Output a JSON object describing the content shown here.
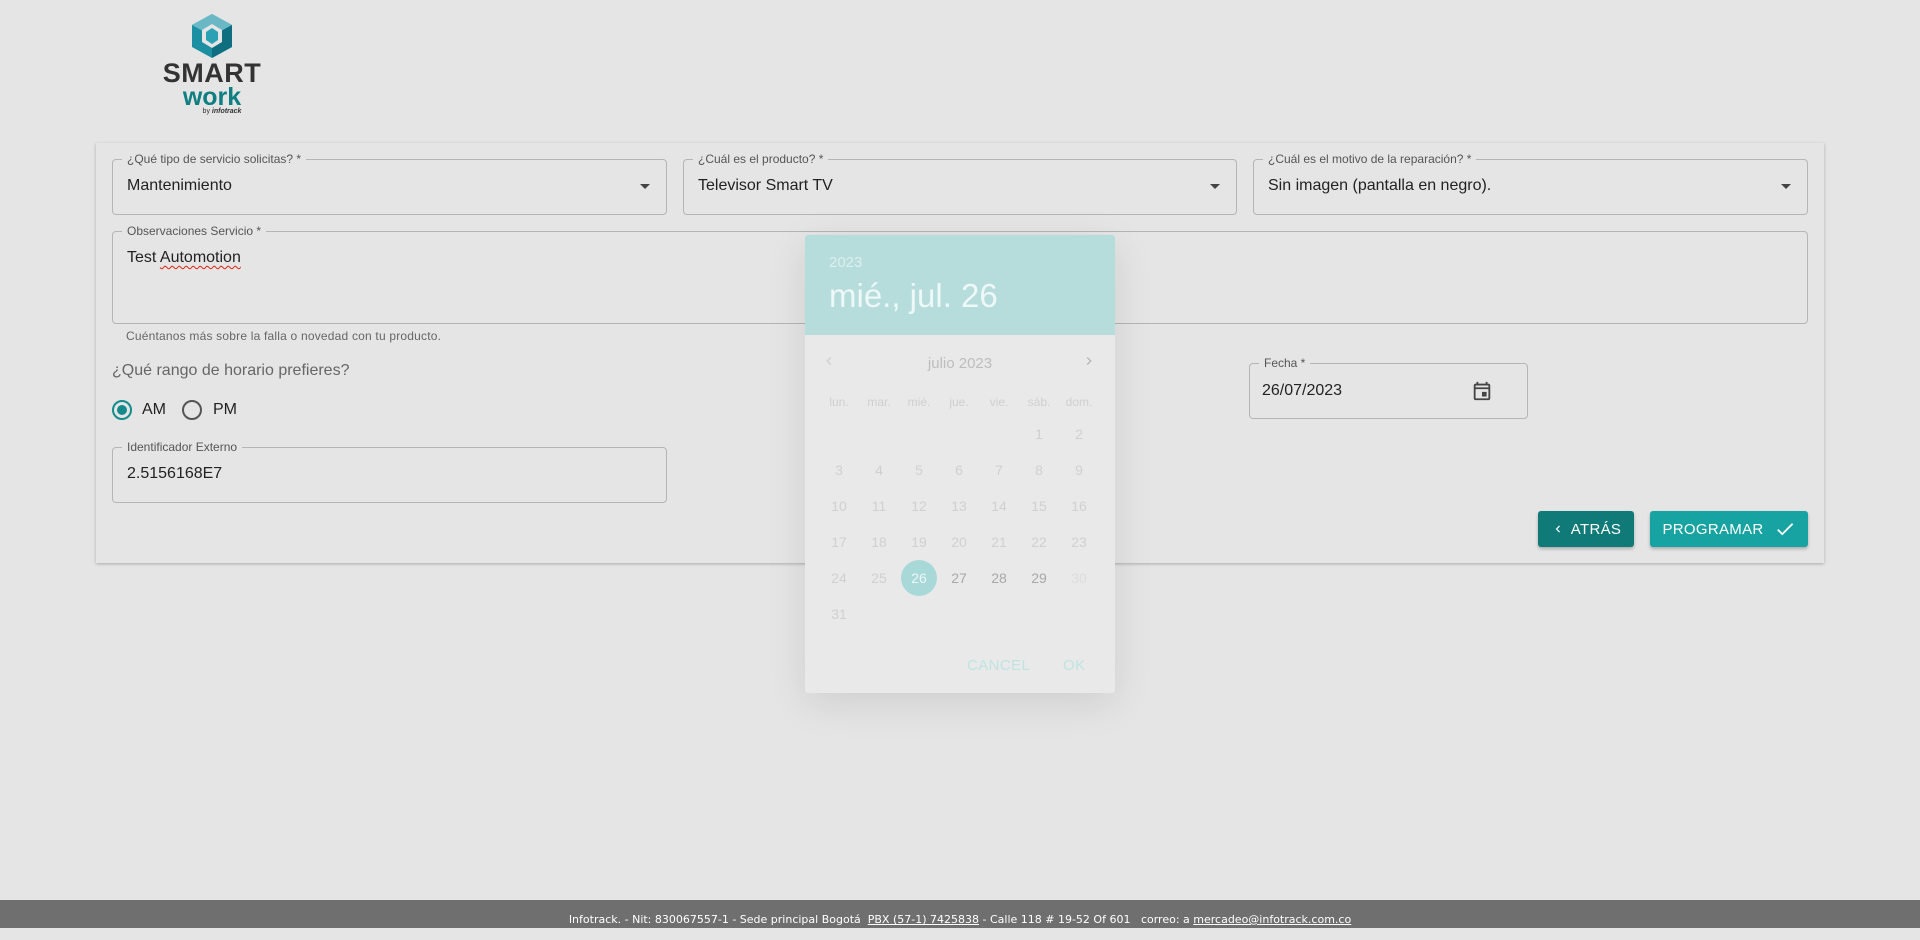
{
  "logo": {
    "line1": "SMART",
    "line2": "work",
    "line3_prefix": "by ",
    "line3_brand": "infotrack"
  },
  "form": {
    "service_type": {
      "label": "¿Qué tipo de servicio solicitas? *",
      "value": "Mantenimiento"
    },
    "product": {
      "label": "¿Cuál es el producto? *",
      "value": "Televisor Smart TV"
    },
    "repair_reason": {
      "label": "¿Cuál es el motivo de la reparación? *",
      "value": "Sin imagen (pantalla en negro)."
    },
    "observations": {
      "label": "Observaciones Servicio *",
      "value_word1": "Test ",
      "value_word2": "Automotion",
      "helper": "Cuéntanos más sobre la falla o novedad con tu producto."
    },
    "schedule": {
      "question": "¿Qué rango de horario prefieres?",
      "am": "AM",
      "pm": "PM",
      "selected": "AM"
    },
    "date": {
      "label": "Fecha *",
      "value": "26/07/2023"
    },
    "external_id": {
      "label": "Identificador Externo",
      "value": "2.5156168E7"
    }
  },
  "buttons": {
    "back": "ATRÁS",
    "schedule": "PROGRAMAR"
  },
  "datepicker": {
    "year": "2023",
    "selected_long": "mié., jul. 26",
    "month_title": "julio 2023",
    "weekdays": [
      "lun.",
      "mar.",
      "mié.",
      "jue.",
      "vie.",
      "sáb.",
      "dom."
    ],
    "weeks": [
      [
        "",
        "",
        "",
        "",
        "",
        "1",
        "2"
      ],
      [
        "3",
        "4",
        "5",
        "6",
        "7",
        "8",
        "9"
      ],
      [
        "10",
        "11",
        "12",
        "13",
        "14",
        "15",
        "16"
      ],
      [
        "17",
        "18",
        "19",
        "20",
        "21",
        "22",
        "23"
      ],
      [
        "24",
        "25",
        "26",
        "27",
        "28",
        "29",
        "30"
      ],
      [
        "31",
        "",
        "",
        "",
        "",
        "",
        ""
      ]
    ],
    "selected_day": "26",
    "cancel": "CANCEL",
    "ok": "OK"
  },
  "footer": {
    "part1": "Infotrack. - Nit: 830067557-1 - Sede principal Bogotá  ",
    "phone": "PBX (57-1) 7425838",
    "part2": " - Calle 118 # 19-52 Of 601   correo: a ",
    "email": "mercadeo@infotrack.com.co"
  },
  "colors": {
    "primary": "#17a3a2",
    "primary_dark": "#0f7a78",
    "header_tint": "#b7dcdc"
  }
}
